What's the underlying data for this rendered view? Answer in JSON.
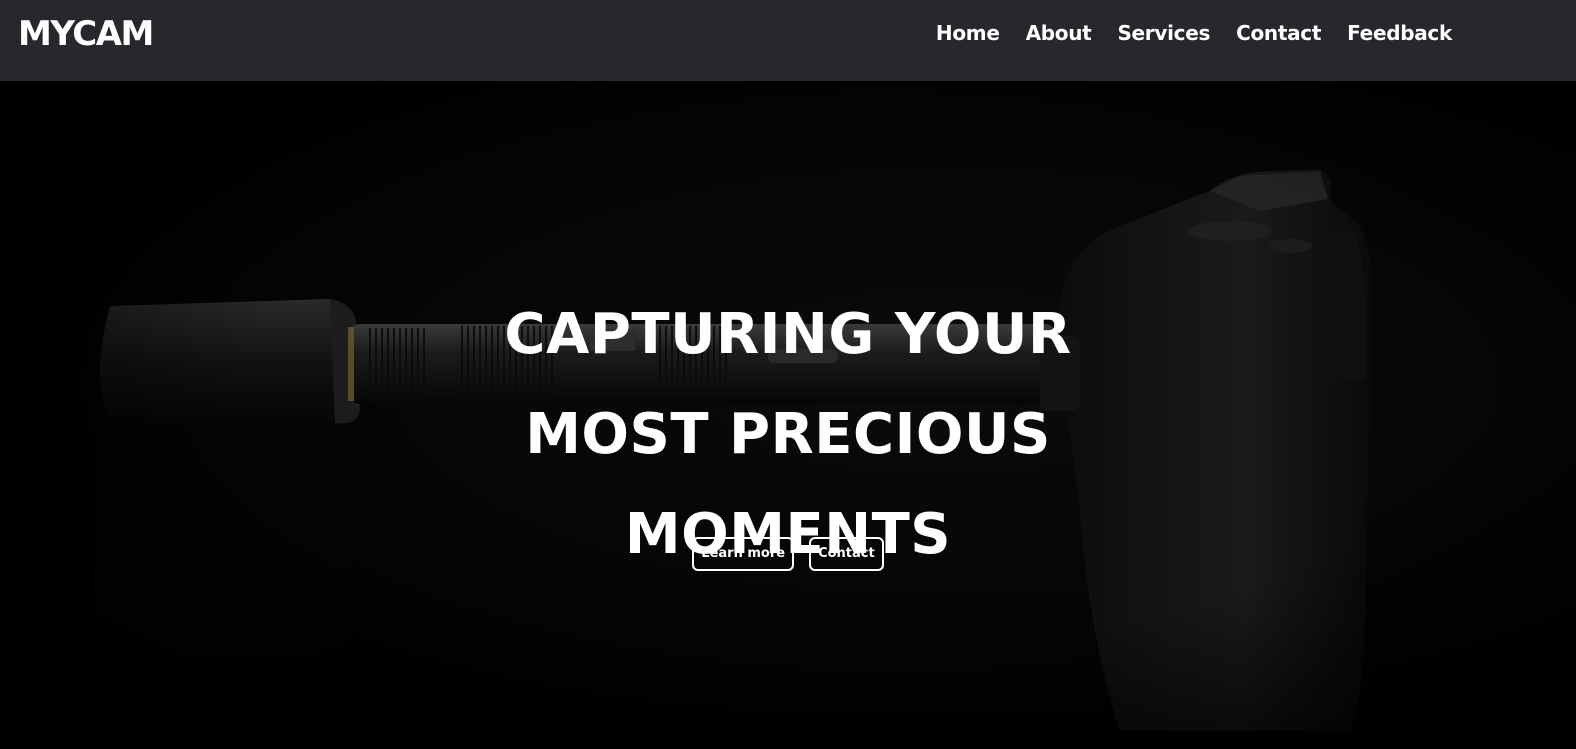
{
  "header": {
    "brand": "MYCAM",
    "nav": [
      "Home",
      "About",
      "Services",
      "Contact",
      "Feedback"
    ]
  },
  "hero": {
    "headline": [
      "CAPTURING YOUR",
      "MOST PRECIOUS",
      "MOMENTS"
    ],
    "buttons": {
      "learn_more": "Learn more",
      "contact": "Contact"
    },
    "background_image": "camera-with-telephoto-lens"
  },
  "colors": {
    "navbar_bg": "#26282b",
    "hero_bg": "#000000",
    "text": "#ffffff"
  }
}
